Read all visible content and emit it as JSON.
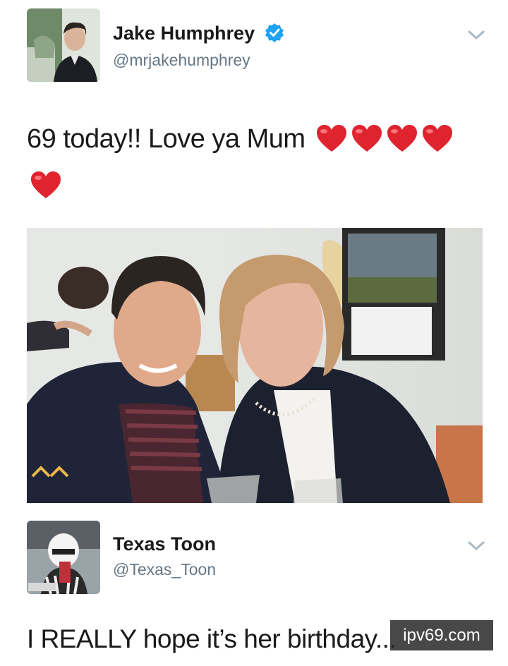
{
  "tweet": {
    "author_name": "Jake Humphrey",
    "author_handle": "@mrjakehumphrey",
    "verified": true,
    "text": "69 today!! Love ya Mum",
    "heart_count": 5,
    "menu_icon": "chevron-down-icon"
  },
  "reply": {
    "author_name": "Texas Toon",
    "author_handle": "@Texas_Toon",
    "text": "I REALLY hope it’s her birthday...",
    "menu_icon": "chevron-down-icon"
  },
  "watermark": "ipv69.com",
  "colors": {
    "verified_blue": "#1da1f2",
    "heart_red": "#e0242f",
    "handle_gray": "#657786",
    "chevron_gray": "#aab8c2"
  }
}
